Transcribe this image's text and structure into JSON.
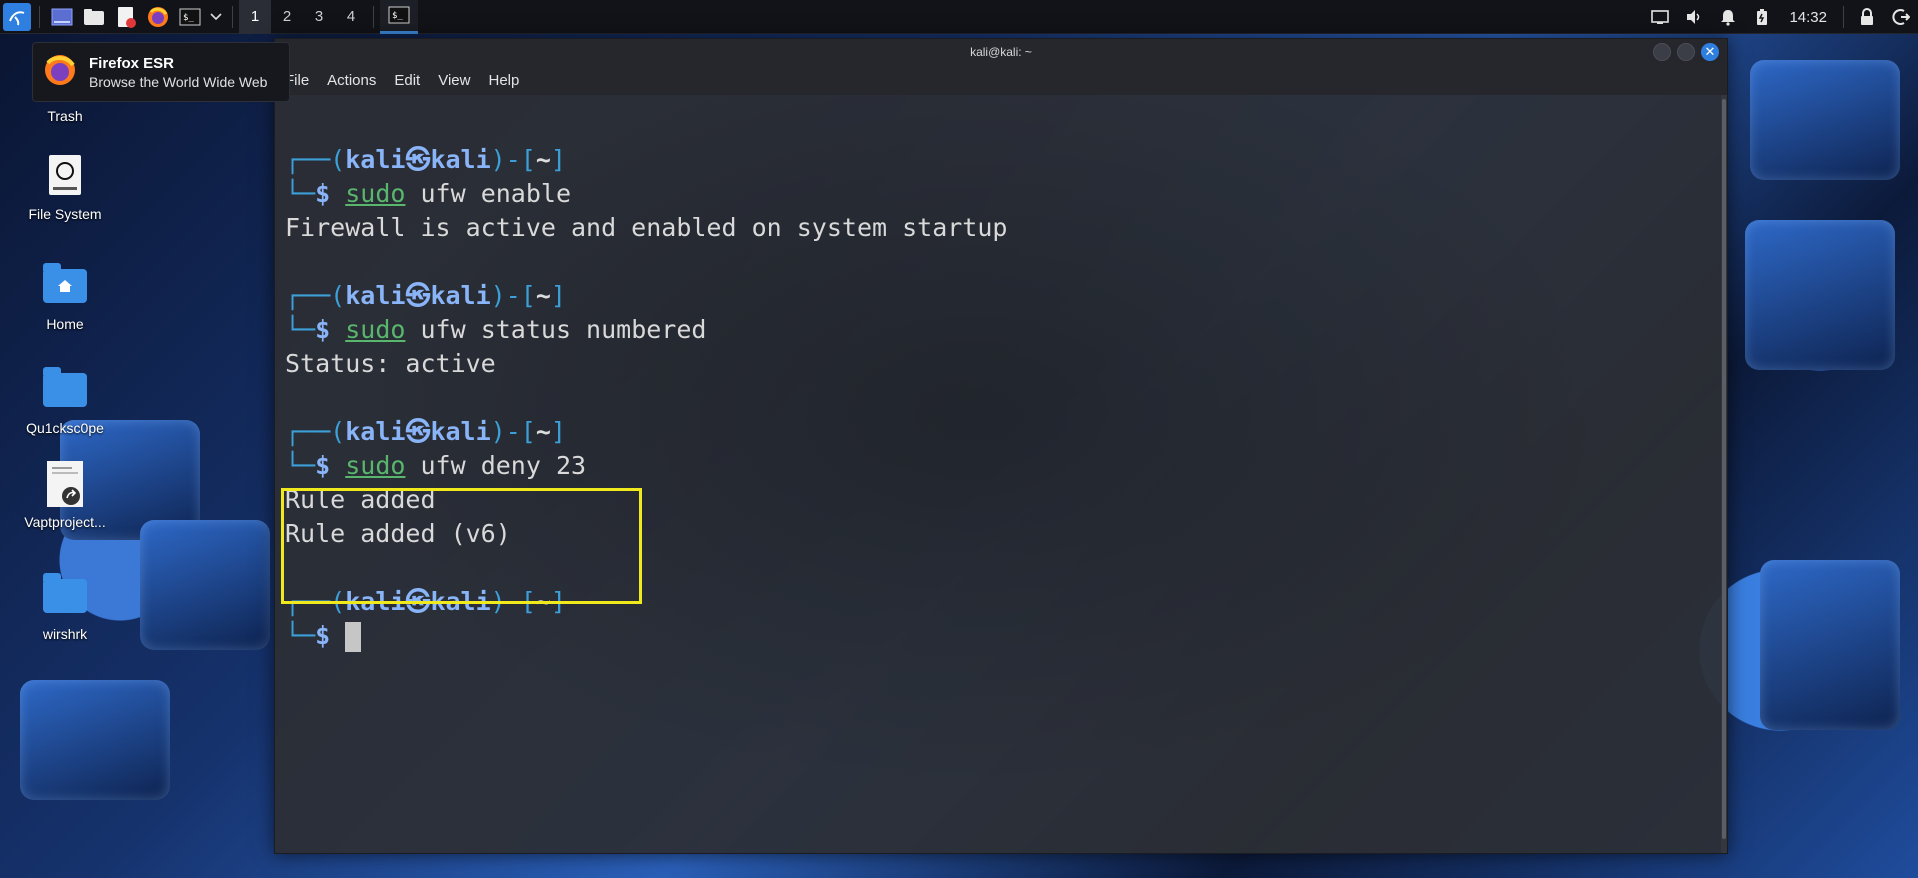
{
  "taskbar": {
    "workspaces": [
      "1",
      "2",
      "3",
      "4"
    ],
    "active_workspace": "1",
    "clock": "14:32"
  },
  "tooltip": {
    "title": "Firefox ESR",
    "subtitle": "Browse the World Wide Web"
  },
  "desktop": {
    "icons": [
      {
        "label": "Trash",
        "icon": "trash-icon"
      },
      {
        "label": "File System",
        "icon": "drive-icon"
      },
      {
        "label": "Home",
        "icon": "home-folder-icon"
      },
      {
        "label": "Qu1cksc0pe",
        "icon": "folder-icon"
      },
      {
        "label": "Vaptproject...",
        "icon": "document-shortcut-icon"
      },
      {
        "label": "wirshrk",
        "icon": "folder-icon"
      }
    ]
  },
  "window": {
    "title": "kali@kali: ~",
    "menu": [
      "File",
      "Actions",
      "Edit",
      "View",
      "Help"
    ]
  },
  "terminal": {
    "prompt_user": "kali",
    "prompt_host": "kali",
    "prompt_dir": "~",
    "sessions": [
      {
        "cmd": "sudo",
        "args": " ufw enable",
        "output": [
          "Firewall is active and enabled on system startup"
        ]
      },
      {
        "cmd": "sudo",
        "args": " ufw status numbered",
        "output": [
          "Status: active"
        ]
      },
      {
        "cmd": "sudo",
        "args": " ufw deny 23",
        "output": [
          "Rule added",
          "Rule added (v6)"
        ]
      }
    ]
  },
  "colors": {
    "accent": "#2f7fe0",
    "highlight": "#f0ea1c",
    "prompt_bracket": "#3c9fd8",
    "prompt_user": "#8ab4f8",
    "command": "#58b76c"
  }
}
